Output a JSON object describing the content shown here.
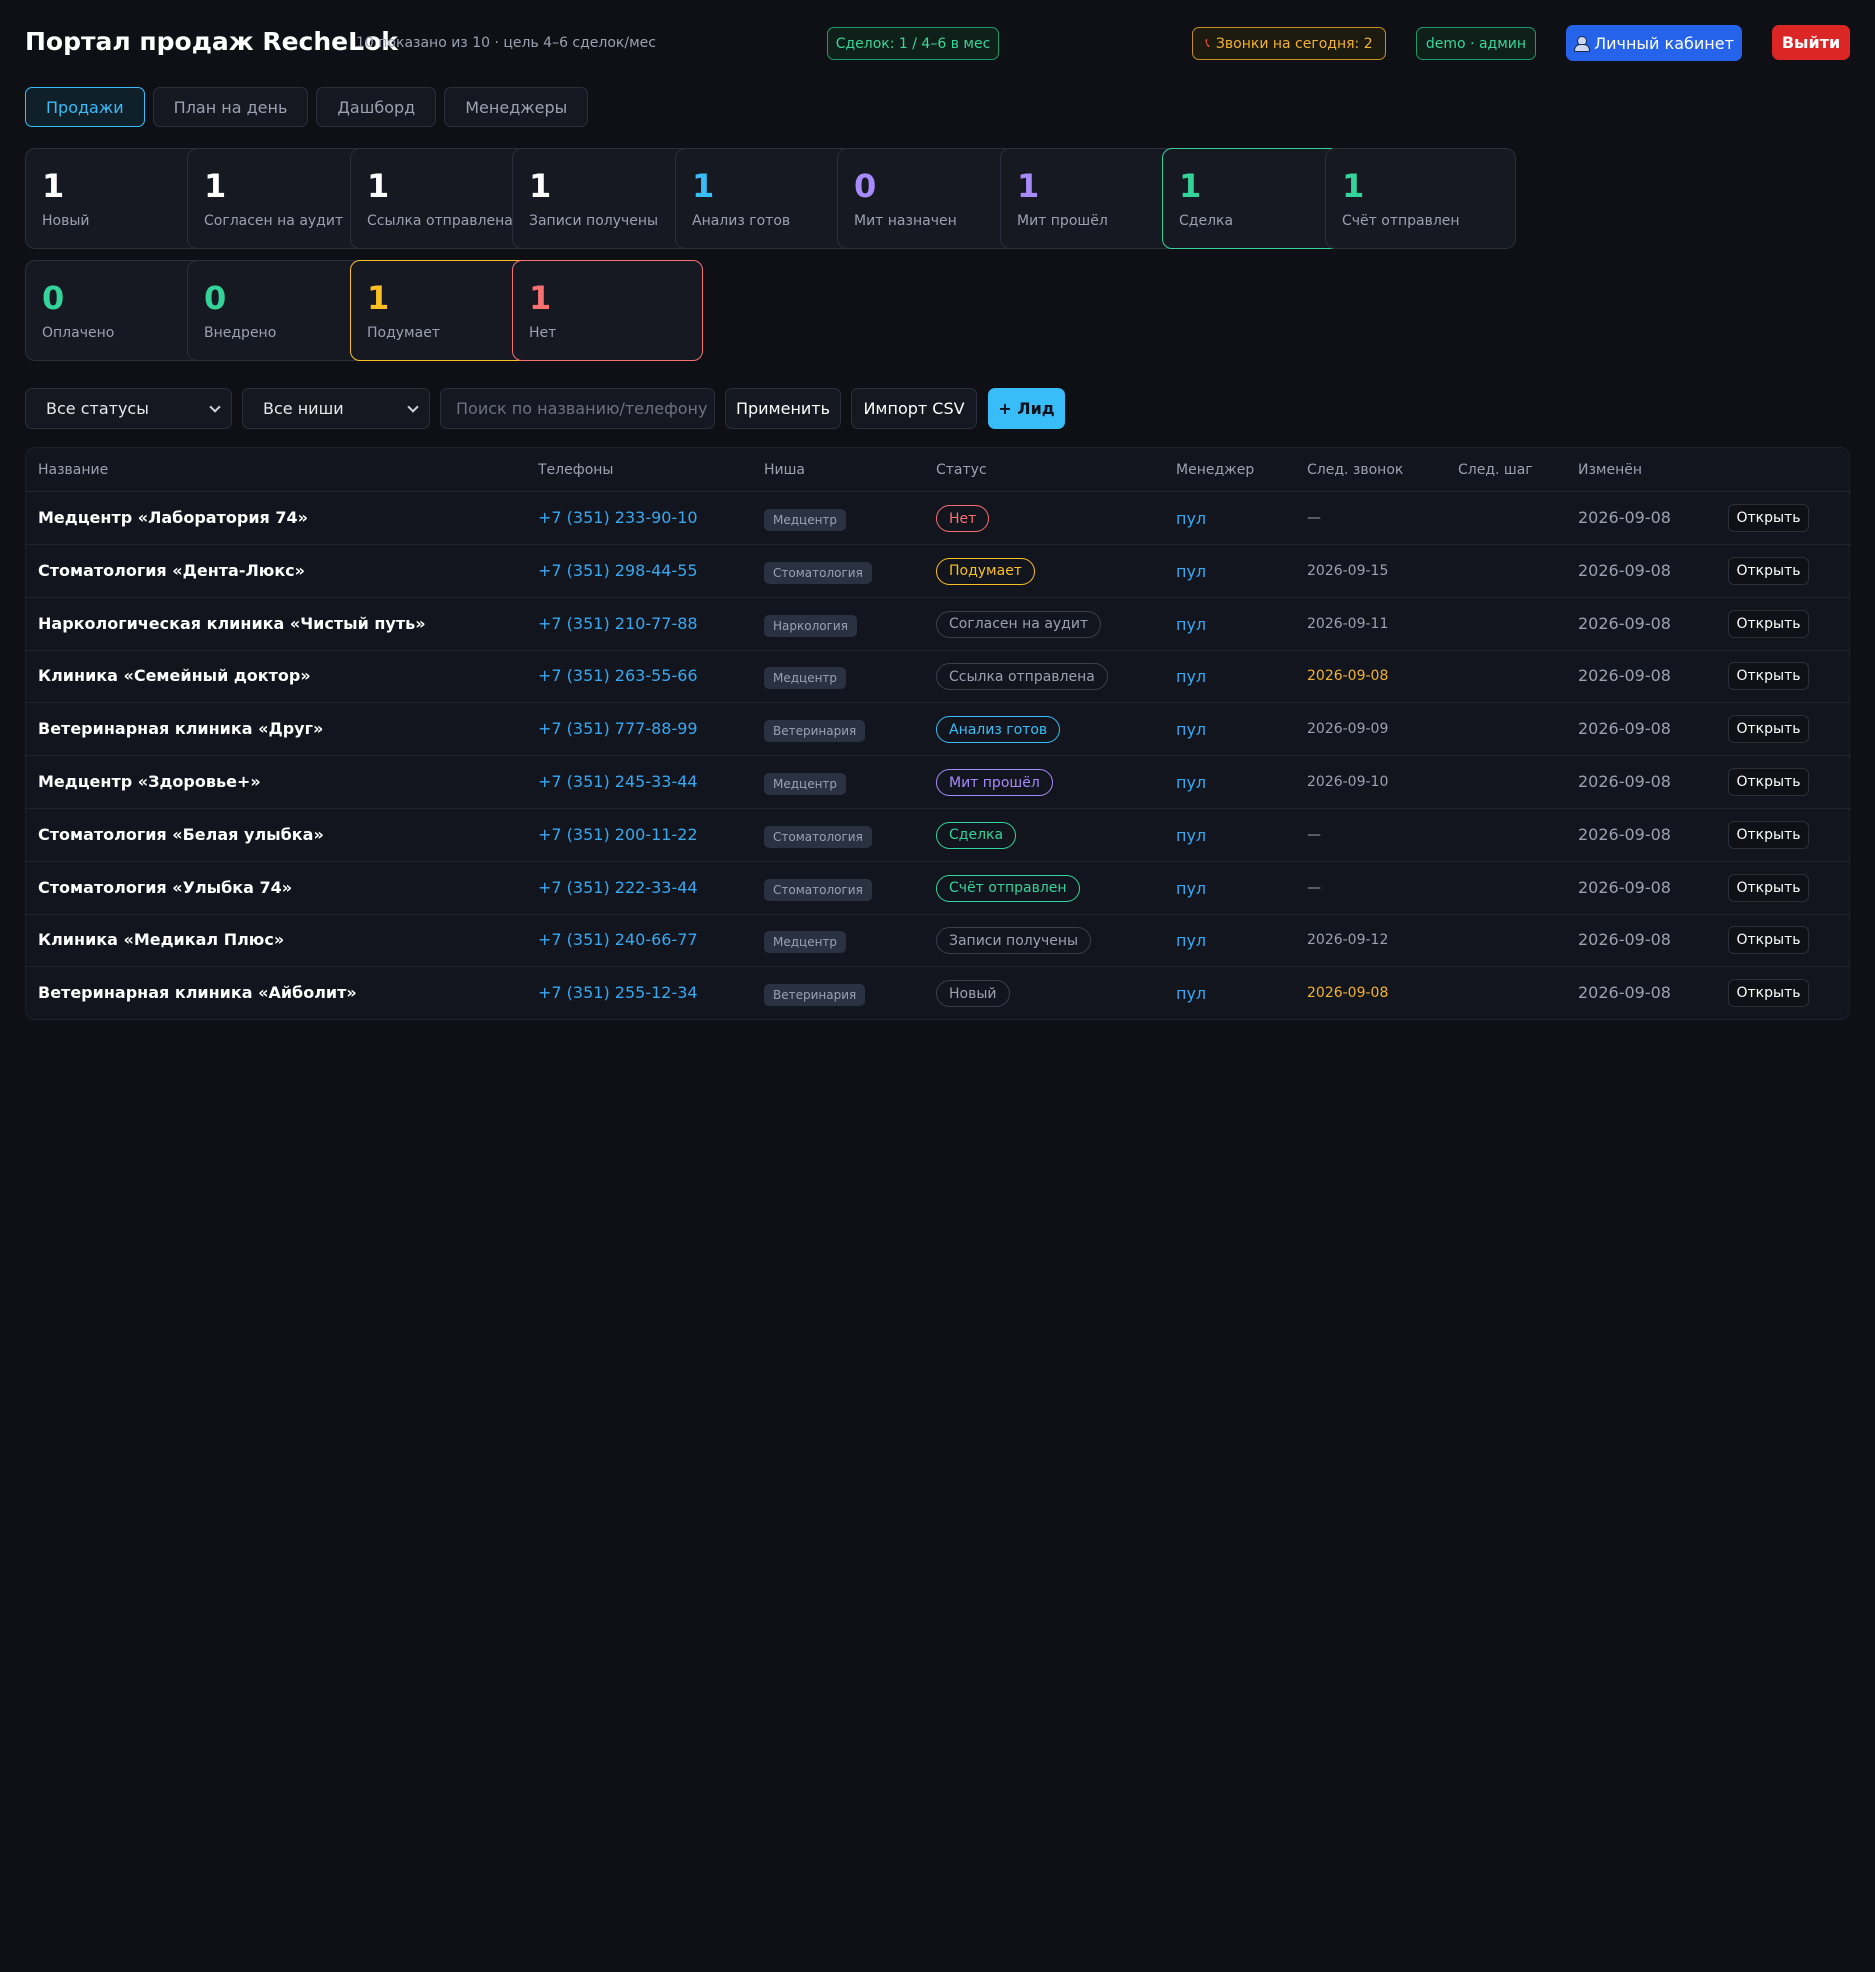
{
  "header": {
    "title": "Портал продаж RecheLok",
    "subtitle": "10 показано из 10 · цель 4–6 сделок/мес",
    "deals_pill": "Сделок: 1 / 4–6 в мес",
    "calls_pill": "Звонки на сегодня: 2",
    "role_pill": "demo · админ",
    "cabinet_button": "Личный кабинет",
    "logout_button": "Выйти"
  },
  "tabs": [
    {
      "label": "Продажи",
      "active": true
    },
    {
      "label": "План на день",
      "active": false
    },
    {
      "label": "Дашборд",
      "active": false
    },
    {
      "label": "Менеджеры",
      "active": false
    }
  ],
  "stats": [
    {
      "value": "1",
      "label": "Новый",
      "color": "#ffffff",
      "border": ""
    },
    {
      "value": "1",
      "label": "Согласен на аудит",
      "color": "#ffffff",
      "border": ""
    },
    {
      "value": "1",
      "label": "Ссылка отправлена",
      "color": "#ffffff",
      "border": ""
    },
    {
      "value": "1",
      "label": "Записи получены",
      "color": "#ffffff",
      "border": ""
    },
    {
      "value": "1",
      "label": "Анализ готов",
      "color": "#38bdf8",
      "border": ""
    },
    {
      "value": "0",
      "label": "Мит назначен",
      "color": "#a78bfa",
      "border": ""
    },
    {
      "value": "1",
      "label": "Мит прошёл",
      "color": "#a78bfa",
      "border": ""
    },
    {
      "value": "1",
      "label": "Сделка",
      "color": "#34d399",
      "border": "#34d399"
    },
    {
      "value": "1",
      "label": "Счёт отправлен",
      "color": "#34d399",
      "border": ""
    },
    {
      "value": "0",
      "label": "Оплачено",
      "color": "#34d399",
      "border": ""
    },
    {
      "value": "0",
      "label": "Внедрено",
      "color": "#34d399",
      "border": ""
    },
    {
      "value": "1",
      "label": "Подумает",
      "color": "#fbbf24",
      "border": "#fbbf24"
    },
    {
      "value": "1",
      "label": "Нет",
      "color": "#f87171",
      "border": "#f87171"
    }
  ],
  "filters": {
    "status_select": "Все статусы",
    "niche_select": "Все ниши",
    "search_placeholder": "Поиск по названию/телефону",
    "apply_button": "Применить",
    "import_button": "Импорт CSV",
    "add_lead_button": "+ Лид"
  },
  "table": {
    "columns": [
      "Название",
      "Телефоны",
      "Ниша",
      "Статус",
      "Менеджер",
      "След. звонок",
      "След. шаг",
      "Изменён"
    ],
    "open_label": "Открыть",
    "rows": [
      {
        "name": "Медцентр «Лаборатория 74»",
        "phone": "+7 (351) 233-90-10",
        "niche": "Медцентр",
        "status": "Нет",
        "status_color": "#f87171",
        "manager": "пул",
        "next_call": "—",
        "next_today": false,
        "changed": "2026-09-08"
      },
      {
        "name": "Стоматология «Дента-Люкс»",
        "phone": "+7 (351) 298-44-55",
        "niche": "Стоматология",
        "status": "Подумает",
        "status_color": "#fbbf24",
        "manager": "пул",
        "next_call": "2026-09-15",
        "next_today": false,
        "changed": "2026-09-08"
      },
      {
        "name": "Наркологическая клиника «Чистый путь»",
        "phone": "+7 (351) 210-77-88",
        "niche": "Наркология",
        "status": "Согласен на аудит",
        "status_color": "",
        "manager": "пул",
        "next_call": "2026-09-11",
        "next_today": false,
        "changed": "2026-09-08"
      },
      {
        "name": "Клиника «Семейный доктор»",
        "phone": "+7 (351) 263-55-66",
        "niche": "Медцентр",
        "status": "Ссылка отправлена",
        "status_color": "",
        "manager": "пул",
        "next_call": "2026-09-08",
        "next_today": true,
        "changed": "2026-09-08"
      },
      {
        "name": "Ветеринарная клиника «Друг»",
        "phone": "+7 (351) 777-88-99",
        "niche": "Ветеринария",
        "status": "Анализ готов",
        "status_color": "#38bdf8",
        "manager": "пул",
        "next_call": "2026-09-09",
        "next_today": false,
        "changed": "2026-09-08"
      },
      {
        "name": "Медцентр «Здоровье+»",
        "phone": "+7 (351) 245-33-44",
        "niche": "Медцентр",
        "status": "Мит прошёл",
        "status_color": "#a78bfa",
        "manager": "пул",
        "next_call": "2026-09-10",
        "next_today": false,
        "changed": "2026-09-08"
      },
      {
        "name": "Стоматология «Белая улыбка»",
        "phone": "+7 (351) 200-11-22",
        "niche": "Стоматология",
        "status": "Сделка",
        "status_color": "#34d399",
        "manager": "пул",
        "next_call": "—",
        "next_today": false,
        "changed": "2026-09-08"
      },
      {
        "name": "Стоматология «Улыбка 74»",
        "phone": "+7 (351) 222-33-44",
        "niche": "Стоматология",
        "status": "Счёт отправлен",
        "status_color": "#34d399",
        "manager": "пул",
        "next_call": "—",
        "next_today": false,
        "changed": "2026-09-08"
      },
      {
        "name": "Клиника «Медикал Плюс»",
        "phone": "+7 (351) 240-66-77",
        "niche": "Медцентр",
        "status": "Записи получены",
        "status_color": "",
        "manager": "пул",
        "next_call": "2026-09-12",
        "next_today": false,
        "changed": "2026-09-08"
      },
      {
        "name": "Ветеринарная клиника «Айболит»",
        "phone": "+7 (351) 255-12-34",
        "niche": "Ветеринария",
        "status": "Новый",
        "status_color": "",
        "manager": "пул",
        "next_call": "2026-09-08",
        "next_today": true,
        "changed": "2026-09-08"
      }
    ]
  }
}
